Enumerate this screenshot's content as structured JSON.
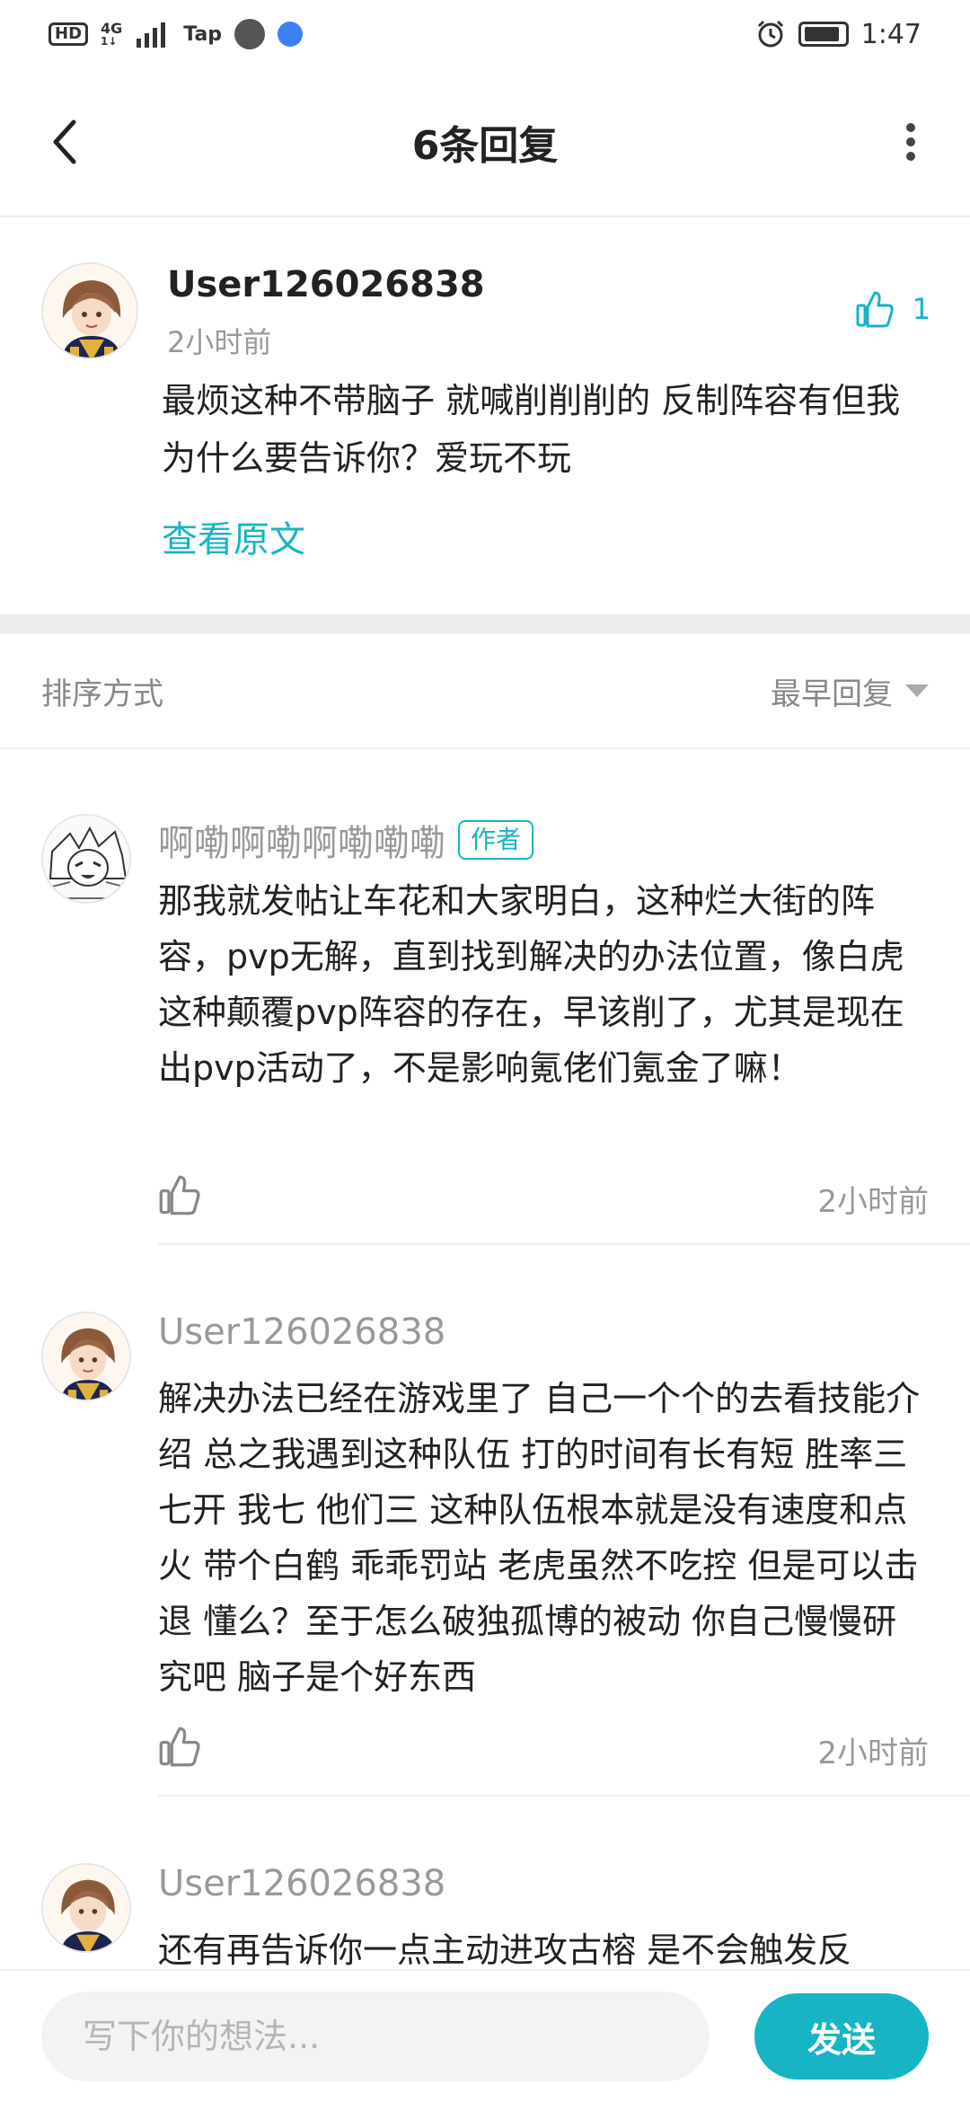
{
  "status_bar": {
    "hd": "HD",
    "network": "4G",
    "network_sub": "1↓",
    "tap": "Tap",
    "time": "1:47"
  },
  "header": {
    "title": "6条回复",
    "back_icon": "chevron-left-icon",
    "more_icon": "more-vertical-icon"
  },
  "main_comment": {
    "username": "User126026838",
    "time": "2小时前",
    "like_count": "1",
    "text": "最烦这种不带脑子 就喊削削削的 反制阵容有但我为什么要告诉你？爱玩不玩",
    "view_original": "查看原文"
  },
  "sort": {
    "label": "排序方式",
    "value": "最早回复"
  },
  "replies": [
    {
      "username": "啊嘞啊嘞啊嘞嘞嘞",
      "badge": "作者",
      "text": "那我就发帖让车花和大家明白，这种烂大街的阵容，pvp无解，直到找到解决的办法位置，像白虎这种颠覆pvp阵容的存在，早该削了，尤其是现在出pvp活动了，不是影响氪佬们氪金了嘛！",
      "time": "2小时前"
    },
    {
      "username": "User126026838",
      "text": "解决办法已经在游戏里了 自己一个个的去看技能介绍 总之我遇到这种队伍 打的时间有长有短 胜率三七开 我七 他们三 这种队伍根本就是没有速度和点火 带个白鹤 乖乖罚站 老虎虽然不吃控 但是可以击退 懂么？至于怎么破独孤博的被动 你自己慢慢研究吧 脑子是个好东西",
      "time": "2小时前"
    },
    {
      "username": "User126026838",
      "text": "还有再告诉你一点主动进攻古榕 是不会触发反"
    }
  ],
  "bottom_bar": {
    "placeholder": "写下你的想法...",
    "send_label": "发送"
  },
  "colors": {
    "accent": "#16b4c4",
    "muted_text": "#999999",
    "divider": "#eeeeee"
  }
}
